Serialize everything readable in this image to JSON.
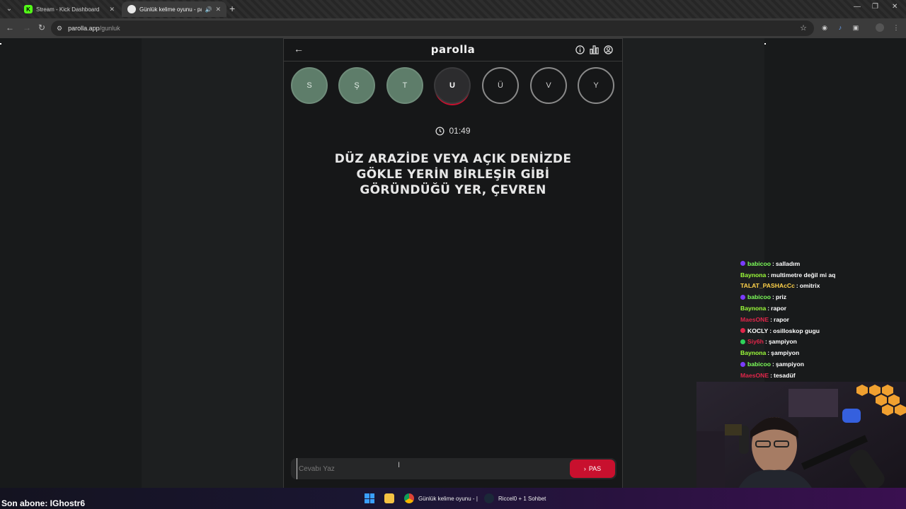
{
  "browser": {
    "tabs": [
      {
        "label": "Stream - Kick Dashboard",
        "favicon_letter": "K"
      },
      {
        "label": "Günlük kelime oyunu - par"
      }
    ],
    "url_domain": "parolla.app",
    "url_path": "/gunluk"
  },
  "app": {
    "brand": "parolla",
    "letters": [
      {
        "letter": "S",
        "state": "done"
      },
      {
        "letter": "Ş",
        "state": "done"
      },
      {
        "letter": "T",
        "state": "done"
      },
      {
        "letter": "U",
        "state": "active"
      },
      {
        "letter": "Ü",
        "state": "todo"
      },
      {
        "letter": "V",
        "state": "todo"
      },
      {
        "letter": "Y",
        "state": "todo"
      }
    ],
    "timer": "01:49",
    "clue_lines": [
      "DÜZ ARAZİDE VEYA AÇIK DENİZDE",
      "GÖKLE YERİN BİRLEŞİR GİBİ",
      "GÖRÜNDÜĞÜ YER, ÇEVREN"
    ],
    "answer_placeholder": "Cevabı Yaz",
    "pass_label": "PAS"
  },
  "chat": [
    {
      "user": "babicoo",
      "color": "#7dff5a",
      "badge": "#7a3cff",
      "text": "salladım"
    },
    {
      "user": "Baynona",
      "color": "#9dff3a",
      "badge": null,
      "text": "multimetre değil mi aq"
    },
    {
      "user": "TALAT_PASHAcCc",
      "color": "#ffd24a",
      "badge": null,
      "text": "omitrix"
    },
    {
      "user": "babicoo",
      "color": "#7dff5a",
      "badge": "#7a3cff",
      "text": "priz"
    },
    {
      "user": "Baynona",
      "color": "#9dff3a",
      "badge": null,
      "text": "rapor"
    },
    {
      "user": "MaesONE",
      "color": "#e0264a",
      "badge": null,
      "text": "rapor"
    },
    {
      "user": "KOCLY",
      "color": "#ffffff",
      "badge": "#e0264a",
      "text": "osilloskop gugu"
    },
    {
      "user": "Siy6h",
      "color": "#e0264a",
      "badge": "#2fd35a",
      "text": "şampiyon"
    },
    {
      "user": "Baynona",
      "color": "#9dff3a",
      "badge": null,
      "text": "şampiyon"
    },
    {
      "user": "babicoo",
      "color": "#7dff5a",
      "badge": "#7a3cff",
      "text": "şampiyon"
    },
    {
      "user": "MaesONE",
      "color": "#e0264a",
      "badge": null,
      "text": "tesadüf"
    }
  ],
  "overlay": {
    "last_sub": "Son abone: IGhostr6"
  },
  "taskbar": {
    "items": [
      {
        "label": "Günlük kelime oyunu - |"
      },
      {
        "label": "Riccel0 + 1 Sohbet"
      }
    ]
  },
  "colors": {
    "accent_red": "#c8102e",
    "done_green": "#5e7d6a",
    "kick_green": "#53fc18"
  }
}
